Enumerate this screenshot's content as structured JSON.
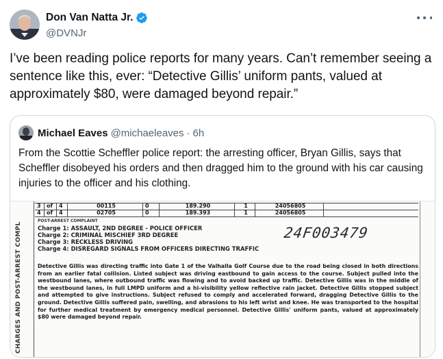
{
  "tweet": {
    "author_name": "Don Van Natta Jr.",
    "author_handle": "@DVNJr",
    "text": "I’ve been reading police reports for many years. Can’t remember seeing a sentence like this, ever: “Detective Gillis’ uniform pants, valued at approximately $80, were damaged beyond repair.”",
    "verified_color": "#1d9bf0"
  },
  "quote": {
    "author_name": "Michael Eaves",
    "author_handle": "@michaeleaves",
    "separator": "·",
    "time": "6h",
    "text": "From the Scottie Scheffler police report: the arresting officer, Bryan Gillis, says that Scheffler disobeyed his orders and then dragged him to the ground with his car causing injuries to the officer and his clothing."
  },
  "report": {
    "side_label": "CHARGES AND POST-ARREST COMPL",
    "rows": [
      {
        "a": "3",
        "b": "of",
        "c": "4",
        "d": "00115",
        "e": "0",
        "f": "189.290",
        "g": "1",
        "h": "24056805"
      },
      {
        "a": "4",
        "b": "of",
        "c": "4",
        "d": "02705",
        "e": "0",
        "f": "189.393",
        "g": "1",
        "h": "24056805"
      }
    ],
    "post_arrest_label": "POST-ARREST COMPLAINT",
    "charges": [
      "Charge 1: ASSAULT, 2ND DEGREE - POLICE OFFICER",
      "Charge 2: CRIMINAL MISCHIEF 3RD DEGREE",
      "Charge 3: RECKLESS DRIVING",
      "Charge 4: DISREGARD SIGNALS FROM OFFICERS DIRECTING TRAFFIC"
    ],
    "case_number": "24F003479",
    "narrative": "Detective Gillis was directing traffic into Gate 1 of the Valhalla Golf Course due to the road being closed in both directions from an earlier fatal collision. Listed subject was driving eastbound to gain access to the course. Subject pulled into the westbound lanes, where outbound traffic was flowing and to avoid backed up traffic. Detective Gillis was in the middle of the westbound lanes, in full LMPD uniform and a hi-visibility yellow reflective rain jacket. Detective Gillis stopped subject and attempted to give instructions. Subject refused to comply and accelerated forward, dragging Detective Gillis to the ground. Detective Gillis suffered pain, swelling, and abrasions to his left wrist and knee. He was transported to the hospital for further medical treatment by emergency medical personnel. Detective Gillis' uniform pants, valued at approximately $80 were damaged beyond repair."
  }
}
